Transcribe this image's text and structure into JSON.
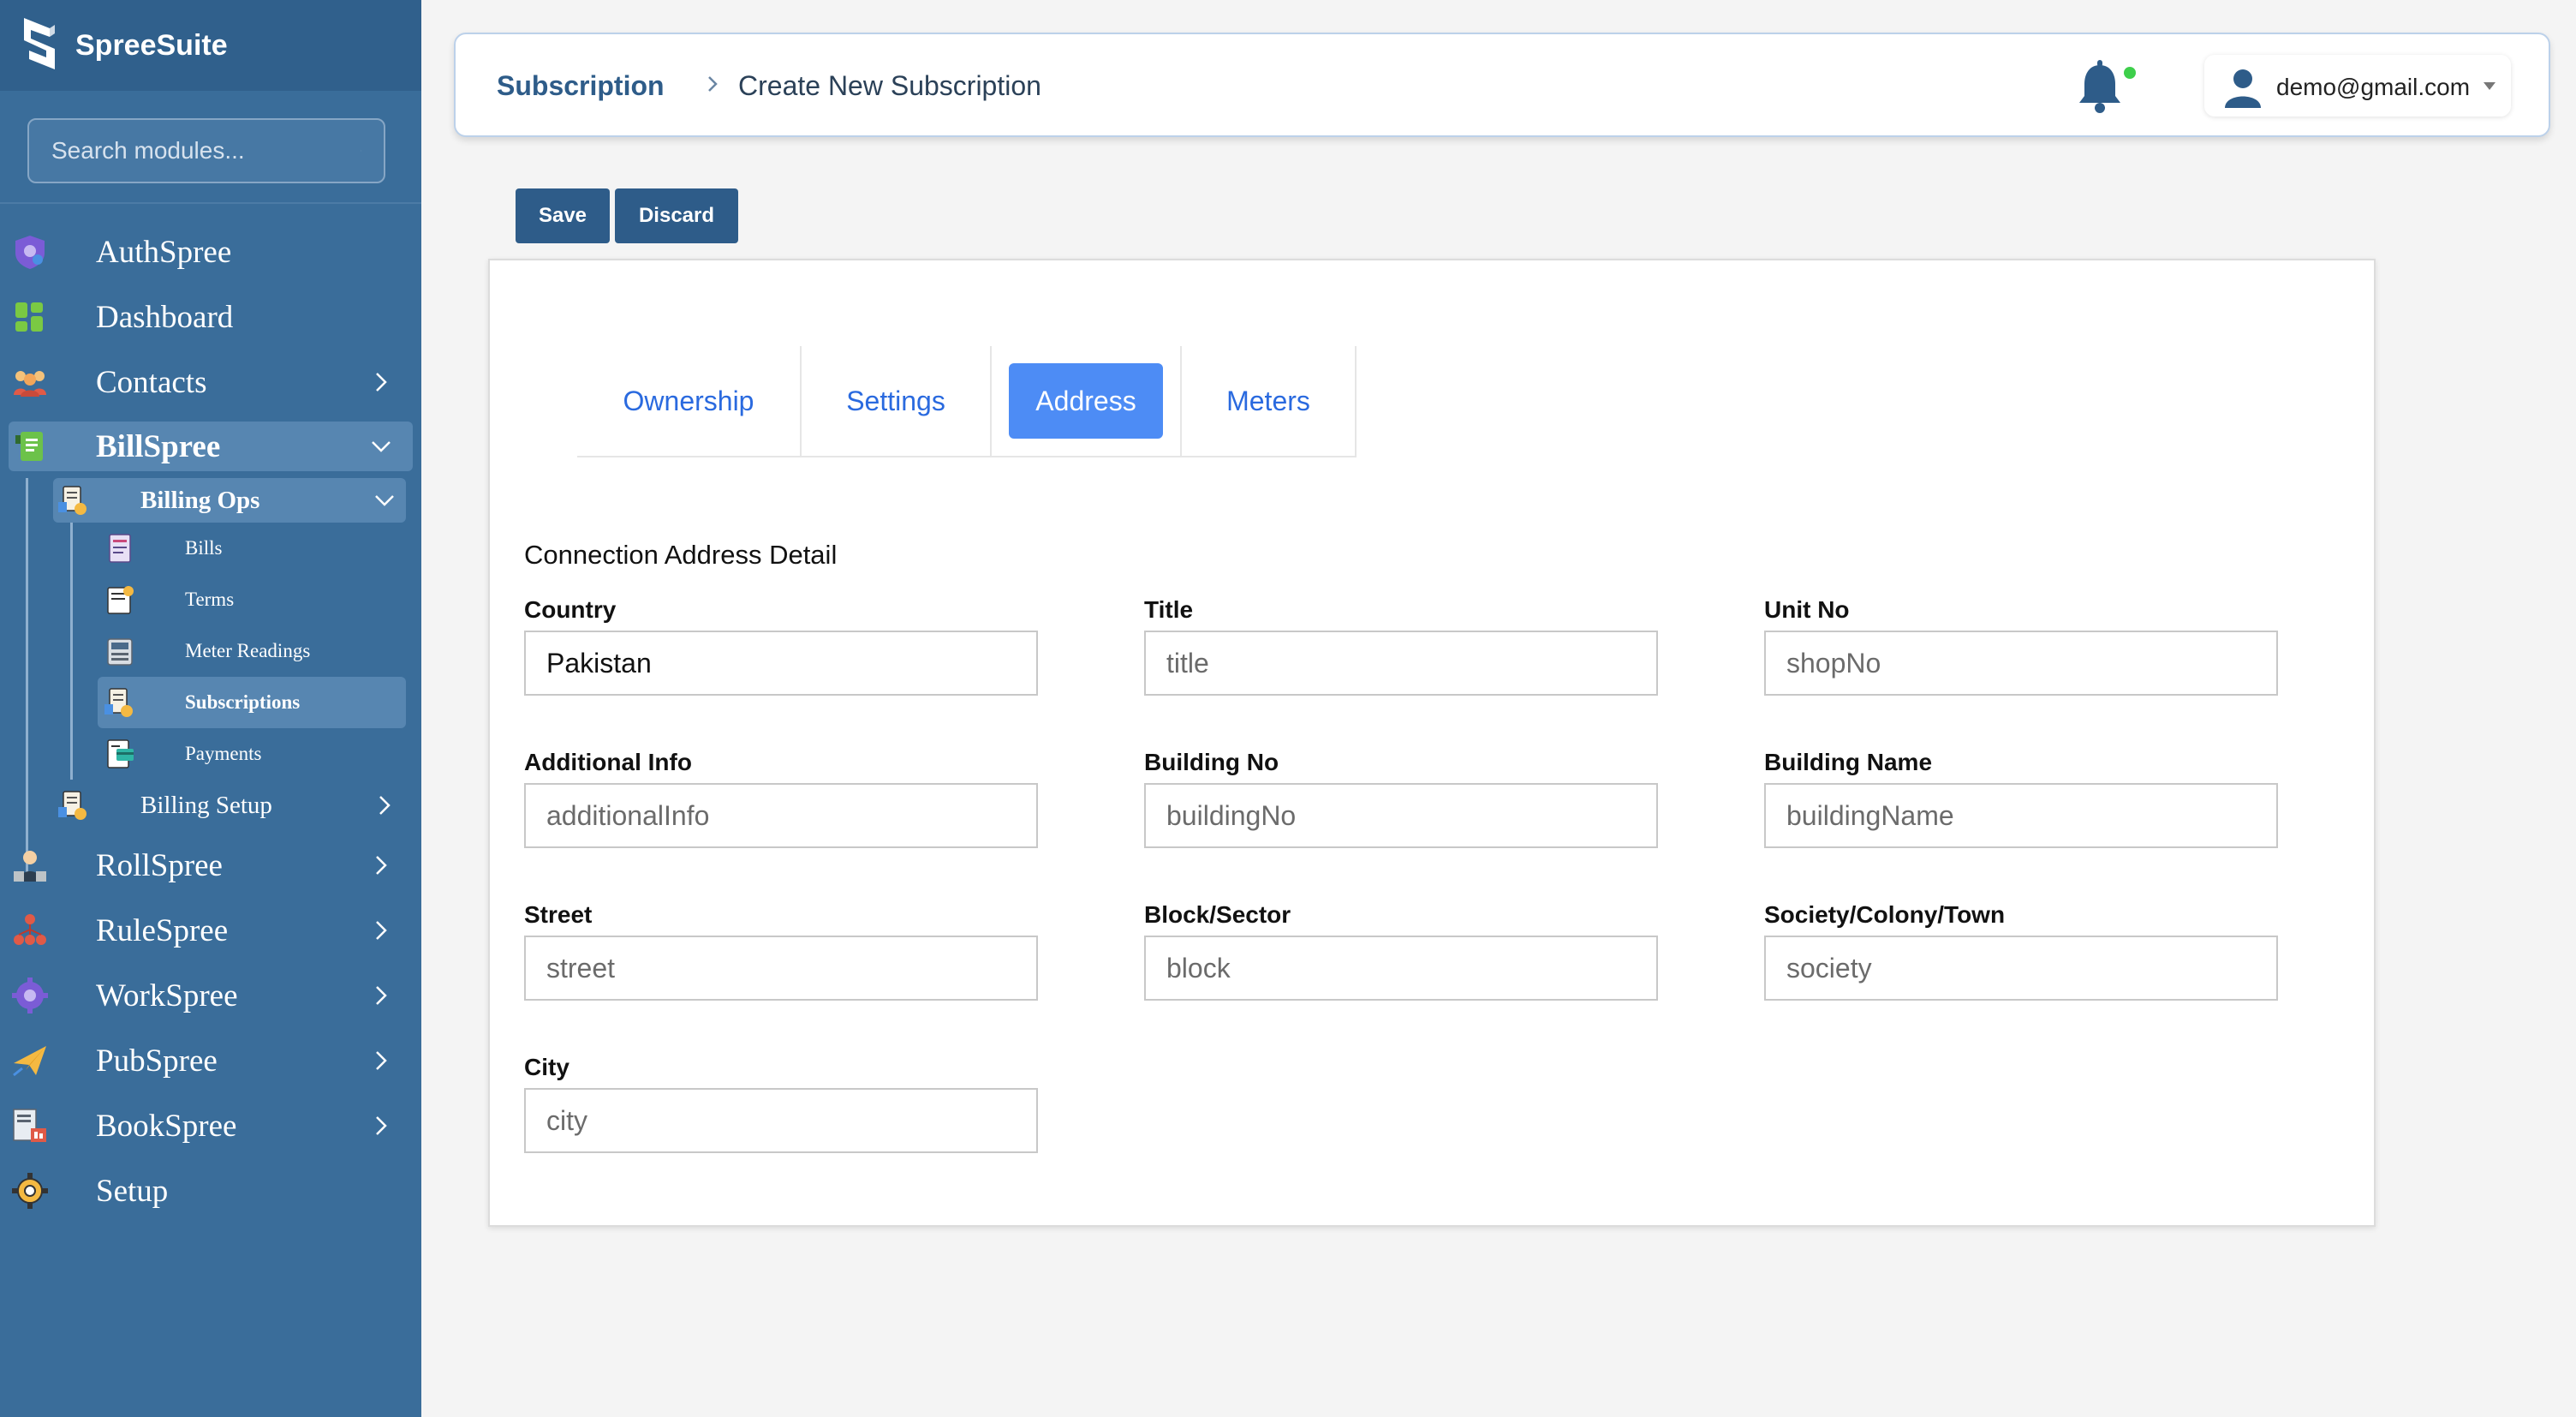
{
  "app": {
    "name": "SpreeSuite"
  },
  "search": {
    "placeholder": "Search modules..."
  },
  "sidebar": {
    "items": [
      {
        "label": "AuthSpree"
      },
      {
        "label": "Dashboard"
      },
      {
        "label": "Contacts"
      },
      {
        "label": "BillSpree"
      },
      {
        "label": "RollSpree"
      },
      {
        "label": "RuleSpree"
      },
      {
        "label": "WorkSpree"
      },
      {
        "label": "PubSpree"
      },
      {
        "label": "BookSpree"
      },
      {
        "label": "Setup"
      }
    ],
    "billspree_sub": [
      {
        "label": "Billing Ops"
      },
      {
        "label": "Billing Setup"
      }
    ],
    "billing_ops_items": [
      {
        "label": "Bills"
      },
      {
        "label": "Terms"
      },
      {
        "label": "Meter Readings"
      },
      {
        "label": "Subscriptions"
      },
      {
        "label": "Payments"
      }
    ]
  },
  "header": {
    "crumb_root": "Subscription",
    "crumb_current": "Create New Subscription",
    "user_email": "demo@gmail.com"
  },
  "toolbar": {
    "save_label": "Save",
    "discard_label": "Discard"
  },
  "tabs": [
    {
      "label": "Ownership"
    },
    {
      "label": "Settings"
    },
    {
      "label": "Address"
    },
    {
      "label": "Meters"
    }
  ],
  "form": {
    "section_title": "Connection Address Detail",
    "fields": [
      {
        "label": "Country",
        "value": "Pakistan",
        "placeholder": ""
      },
      {
        "label": "Title",
        "value": "",
        "placeholder": "title"
      },
      {
        "label": "Unit No",
        "value": "",
        "placeholder": "shopNo"
      },
      {
        "label": "Additional Info",
        "value": "",
        "placeholder": "additionalInfo"
      },
      {
        "label": "Building No",
        "value": "",
        "placeholder": "buildingNo"
      },
      {
        "label": "Building Name",
        "value": "",
        "placeholder": "buildingName"
      },
      {
        "label": "Street",
        "value": "",
        "placeholder": "street"
      },
      {
        "label": "Block/Sector",
        "value": "",
        "placeholder": "block"
      },
      {
        "label": "Society/Colony/Town",
        "value": "",
        "placeholder": "society"
      },
      {
        "label": "City",
        "value": "",
        "placeholder": "city"
      }
    ]
  },
  "colors": {
    "sidebar_bg": "#3a6d9a",
    "brand_bg": "#30608c",
    "active_item": "#5786b1",
    "primary_button": "#2e5c89",
    "active_tab": "#4d8cf5",
    "tab_text": "#2a6adf",
    "notification_dot": "#3ecf4b"
  }
}
